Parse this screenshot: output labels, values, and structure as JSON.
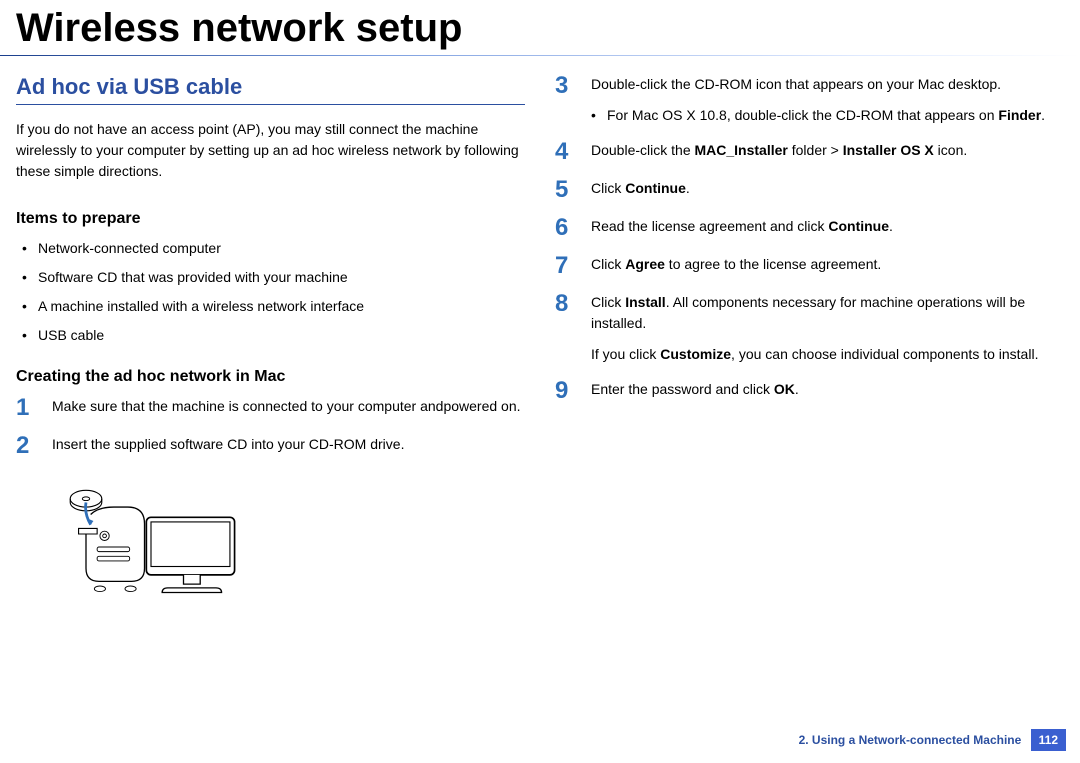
{
  "title": "Wireless network setup",
  "section": {
    "heading": "Ad hoc via USB cable",
    "intro": "If you do not have an access point (AP), you may still connect the machine wirelessly to your computer by setting up an ad hoc wireless network by following these simple directions."
  },
  "prepare": {
    "heading": "Items to prepare",
    "items": [
      "Network-connected computer",
      "Software CD that was provided with your machine",
      "A machine installed with a wireless network interface",
      "USB cable"
    ]
  },
  "creating": {
    "heading": "Creating the ad hoc network in Mac"
  },
  "steps_left": [
    {
      "n": "1",
      "text": "Make sure that the machine is connected to your computer andpowered on."
    },
    {
      "n": "2",
      "text": "Insert the supplied software CD into your CD-ROM drive."
    }
  ],
  "steps_right": [
    {
      "n": "3",
      "text": "Double-click the CD-ROM icon that appears on your Mac desktop.",
      "sub_pre": "For Mac OS X 10.8, double-click the CD-ROM that appears on ",
      "sub_bold": "Finder",
      "sub_post": "."
    },
    {
      "n": "4",
      "pre": "Double-click the ",
      "b1": "MAC_Installer",
      "mid": " folder > ",
      "b2": "Installer OS X",
      "post": " icon."
    },
    {
      "n": "5",
      "pre": "Click ",
      "b1": "Continue",
      "post": "."
    },
    {
      "n": "6",
      "pre": "Read the license agreement and click ",
      "b1": "Continue",
      "post": "."
    },
    {
      "n": "7",
      "pre": "Click ",
      "b1": "Agree",
      "post": " to agree to the license agreement."
    },
    {
      "n": "8",
      "pre": "Click ",
      "b1": "Install",
      "post": ". All components necessary for machine operations will be installed.",
      "note_pre": "If you click ",
      "note_b": "Customize",
      "note_post": ", you can choose individual components to install."
    },
    {
      "n": "9",
      "pre": "Enter the password and click ",
      "b1": "OK",
      "post": "."
    }
  ],
  "footer": {
    "chapter": "2.  Using a Network-connected Machine",
    "page": "112"
  }
}
